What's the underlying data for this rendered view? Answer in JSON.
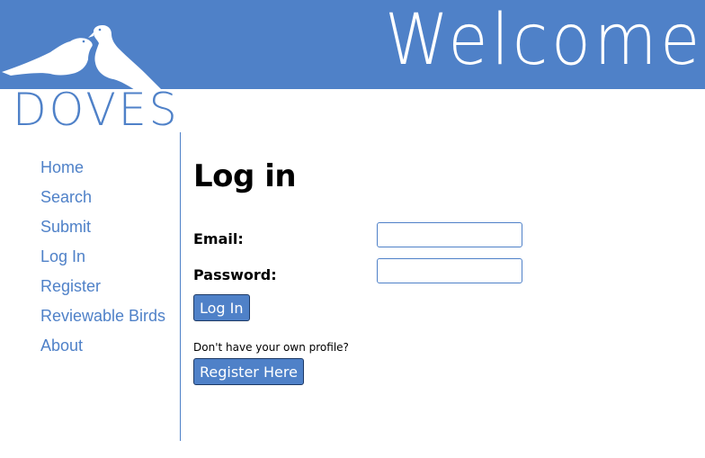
{
  "header": {
    "welcome_text": "Welcome t",
    "bg_color": "#4f81c8"
  },
  "logo": {
    "text": "DOVES",
    "icon": "doves-icon"
  },
  "nav": {
    "items": [
      "Home",
      "Search",
      "Submit",
      "Log In",
      "Register",
      "Reviewable Birds",
      "About"
    ]
  },
  "form": {
    "title": "Log in",
    "email_label": "Email:",
    "email_value": "",
    "password_label": "Password:",
    "password_value": "",
    "login_button": "Log In",
    "no_profile_text": "Don't have your own profile?",
    "register_button": "Register Here"
  },
  "colors": {
    "accent": "#4f81c8",
    "button_border": "#1e3a66"
  }
}
